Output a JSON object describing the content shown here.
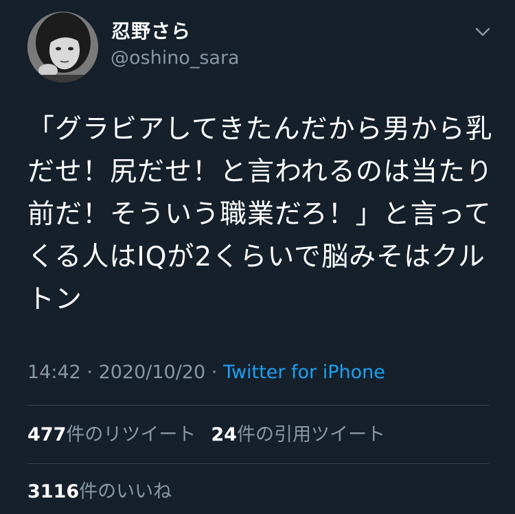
{
  "user": {
    "display_name": "忍野さら",
    "handle": "@oshino_sara",
    "avatar": "avatar-photo"
  },
  "menu_icon": "chevron-down-icon",
  "tweet": {
    "text": "「グラビアしてきたんだから男から乳だせ！尻だせ！と言われるのは当たり前だ！そういう職業だろ！」と言ってくる人はIQが2くらいで脳みそはクルトン"
  },
  "meta": {
    "time": "14:42",
    "separator1": " · ",
    "date": "2020/10/20",
    "separator2": " · ",
    "source": "Twitter for iPhone"
  },
  "stats": {
    "retweets_count": "477",
    "retweets_label": "件のリツイート",
    "quotes_count": "24",
    "quotes_label": "件の引用ツイート",
    "likes_count": "3116",
    "likes_label": "件のいいね"
  },
  "colors": {
    "background": "#15202b",
    "text": "#ffffff",
    "secondary": "#8899a6",
    "link": "#1da1f2",
    "divider": "#38444d"
  }
}
